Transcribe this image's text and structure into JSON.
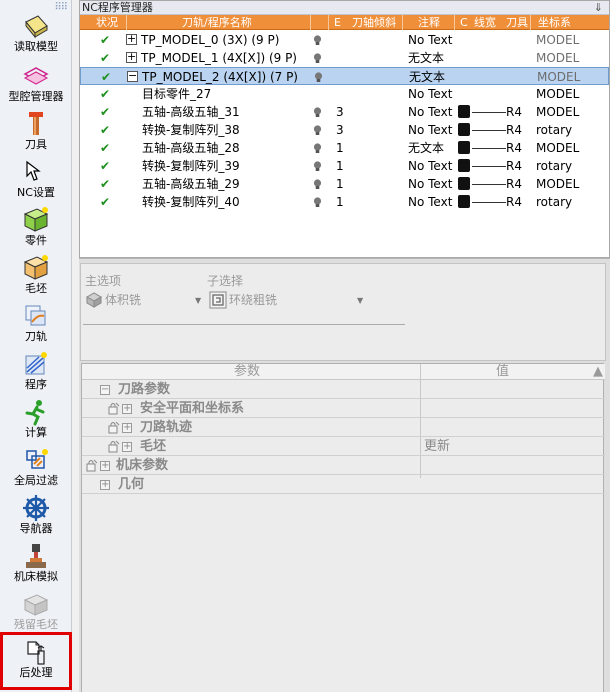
{
  "toolbar": {
    "items": [
      {
        "label": "读取模型",
        "icon": "read-model-icon"
      },
      {
        "label": "型腔管理器",
        "icon": "cavity-manager-icon"
      },
      {
        "label": "刀具",
        "icon": "tool-icon"
      },
      {
        "label": "NC设置",
        "icon": "nc-settings-icon"
      },
      {
        "label": "零件",
        "icon": "part-icon"
      },
      {
        "label": "毛坯",
        "icon": "stock-icon"
      },
      {
        "label": "刀轨",
        "icon": "toolpath-icon"
      },
      {
        "label": "程序",
        "icon": "program-icon"
      },
      {
        "label": "计算",
        "icon": "calculate-icon"
      },
      {
        "label": "全局过滤",
        "icon": "global-filter-icon"
      },
      {
        "label": "导航器",
        "icon": "navigator-icon"
      },
      {
        "label": "机床模拟",
        "icon": "machine-sim-icon"
      },
      {
        "label": "残留毛坯",
        "icon": "residual-stock-icon"
      },
      {
        "label": "后处理",
        "icon": "post-process-icon"
      }
    ]
  },
  "nc_manager": {
    "title": "NC程序管理器",
    "pin": "⇓",
    "columns": {
      "status": "状况",
      "name": "刀轨/程序名称",
      "e": "E",
      "tilt": "刀轴倾斜",
      "note": "注释",
      "c": "C",
      "line_width": "线宽",
      "tool": "刀具",
      "coord": "坐标系"
    },
    "rows": [
      {
        "name": "TP_MODEL_0 (3X) (9 P)",
        "expander": "+",
        "tilt": "",
        "note": "No Text",
        "tool": "",
        "coord": "MODEL"
      },
      {
        "name": "TP_MODEL_1 (4X[X]) (9 P)",
        "expander": "+",
        "tilt": "",
        "note": "无文本",
        "tool": "",
        "coord": "MODEL"
      },
      {
        "name": "TP_MODEL_2 (4X[X]) (7 P)",
        "expander": "−",
        "tilt": "",
        "note": "无文本",
        "tool": "",
        "coord": "MODEL"
      },
      {
        "name": "目标零件_27",
        "expander": "",
        "tilt": "",
        "note": "No Text",
        "tool": "",
        "coord": "MODEL"
      },
      {
        "name": "五轴-高级五轴_31",
        "expander": "",
        "tilt": "3",
        "note": "No Text",
        "tool": "R4",
        "coord": "MODEL"
      },
      {
        "name": "转换-复制阵列_38",
        "expander": "",
        "tilt": "3",
        "note": "No Text",
        "tool": "R4",
        "coord": "rotary"
      },
      {
        "name": "五轴-高级五轴_28",
        "expander": "",
        "tilt": "1",
        "note": "无文本",
        "tool": "R4",
        "coord": "MODEL"
      },
      {
        "name": "转换-复制阵列_39",
        "expander": "",
        "tilt": "1",
        "note": "No Text",
        "tool": "R4",
        "coord": "rotary"
      },
      {
        "name": "五轴-高级五轴_29",
        "expander": "",
        "tilt": "1",
        "note": "No Text",
        "tool": "R4",
        "coord": "MODEL"
      },
      {
        "name": "转换-复制阵列_40",
        "expander": "",
        "tilt": "1",
        "note": "No Text",
        "tool": "R4",
        "coord": "rotary"
      }
    ]
  },
  "selector": {
    "main_title": "主选项",
    "main_value": "体积铣",
    "sub_title": "子选择",
    "sub_value": "环绕粗铣"
  },
  "params": {
    "col_param": "参数",
    "col_value": "值",
    "rows": [
      {
        "name": "刀路参数",
        "value": ""
      },
      {
        "name": "安全平面和坐标系",
        "value": ""
      },
      {
        "name": "刀路轨迹",
        "value": ""
      },
      {
        "name": "毛坯",
        "value": "更新"
      },
      {
        "name": "机床参数",
        "value": ""
      },
      {
        "name": "几何",
        "value": ""
      }
    ]
  }
}
